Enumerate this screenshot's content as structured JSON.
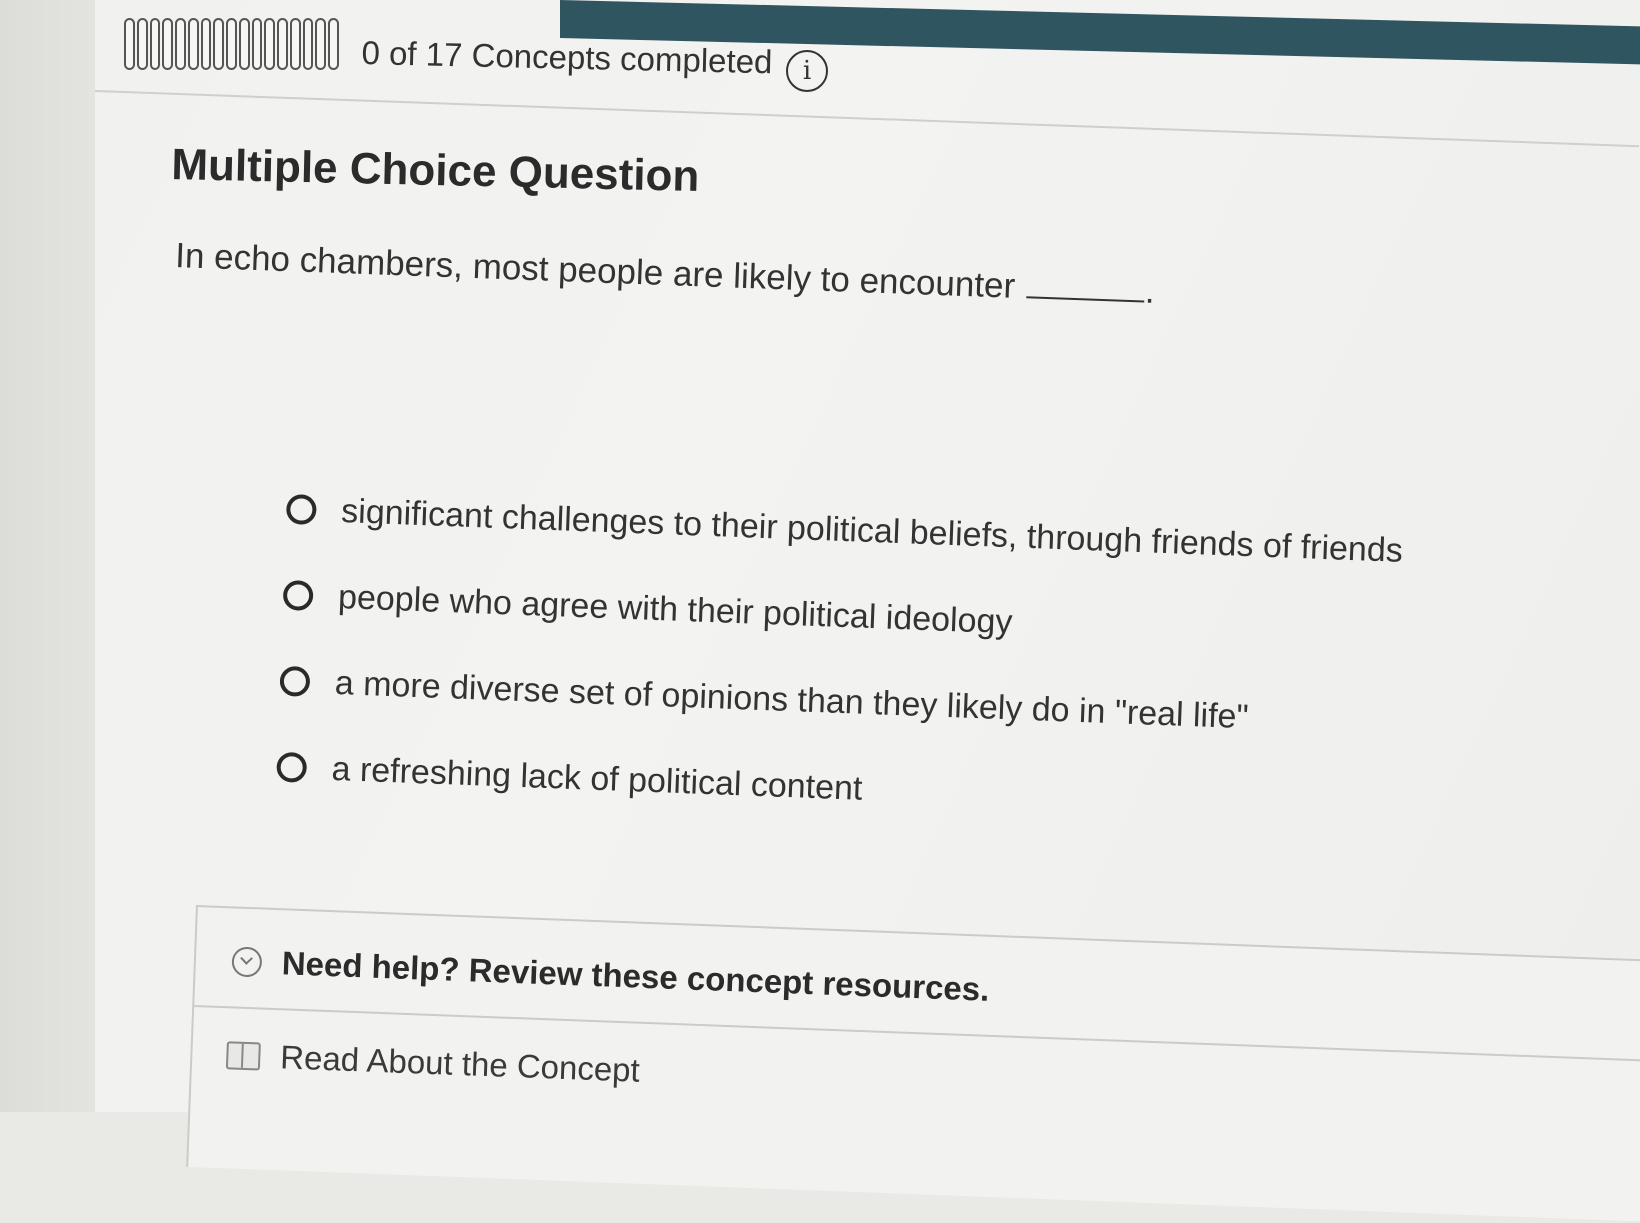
{
  "progress": {
    "completed": 0,
    "total": 17,
    "label": "0 of 17 Concepts completed",
    "segments": 17
  },
  "question": {
    "heading": "Multiple Choice Question",
    "prompt": "In echo chambers, most people are likely to encounter",
    "prompt_end": ".",
    "options": [
      {
        "label": "significant challenges to their political beliefs, through friends of friends",
        "selected": false
      },
      {
        "label": "people who agree with their political ideology",
        "selected": false
      },
      {
        "label": "a more diverse set of opinions than they likely do in \"real life\"",
        "selected": false
      },
      {
        "label": "a refreshing lack of political content",
        "selected": false
      }
    ]
  },
  "help": {
    "title": "Need help? Review these concept resources.",
    "read_label": "Read About the Concept"
  },
  "icons": {
    "info": "info-icon",
    "chevron": "chevron-down-icon",
    "book": "book-icon"
  },
  "colors": {
    "header_strip": "#2f5560",
    "text": "#2b2b2b"
  }
}
